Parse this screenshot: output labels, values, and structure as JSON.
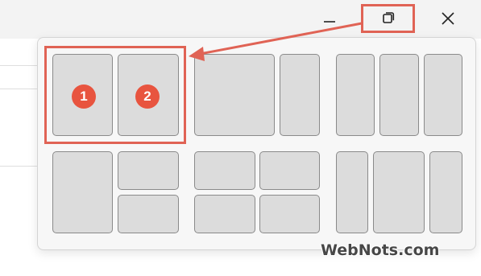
{
  "caption_buttons": {
    "minimize_icon": "minimize-icon",
    "maximize_icon": "restore-icon",
    "close_icon": "close-icon"
  },
  "snap_layouts": {
    "highlighted_layout": "two-equal-columns",
    "zone_numbers": [
      "1",
      "2"
    ]
  },
  "colors": {
    "highlight": "#e06355",
    "badge": "#e8543f",
    "zone_fill": "#dcdcdc",
    "zone_border": "#8a8a8a"
  },
  "watermark": "WebNots.com"
}
